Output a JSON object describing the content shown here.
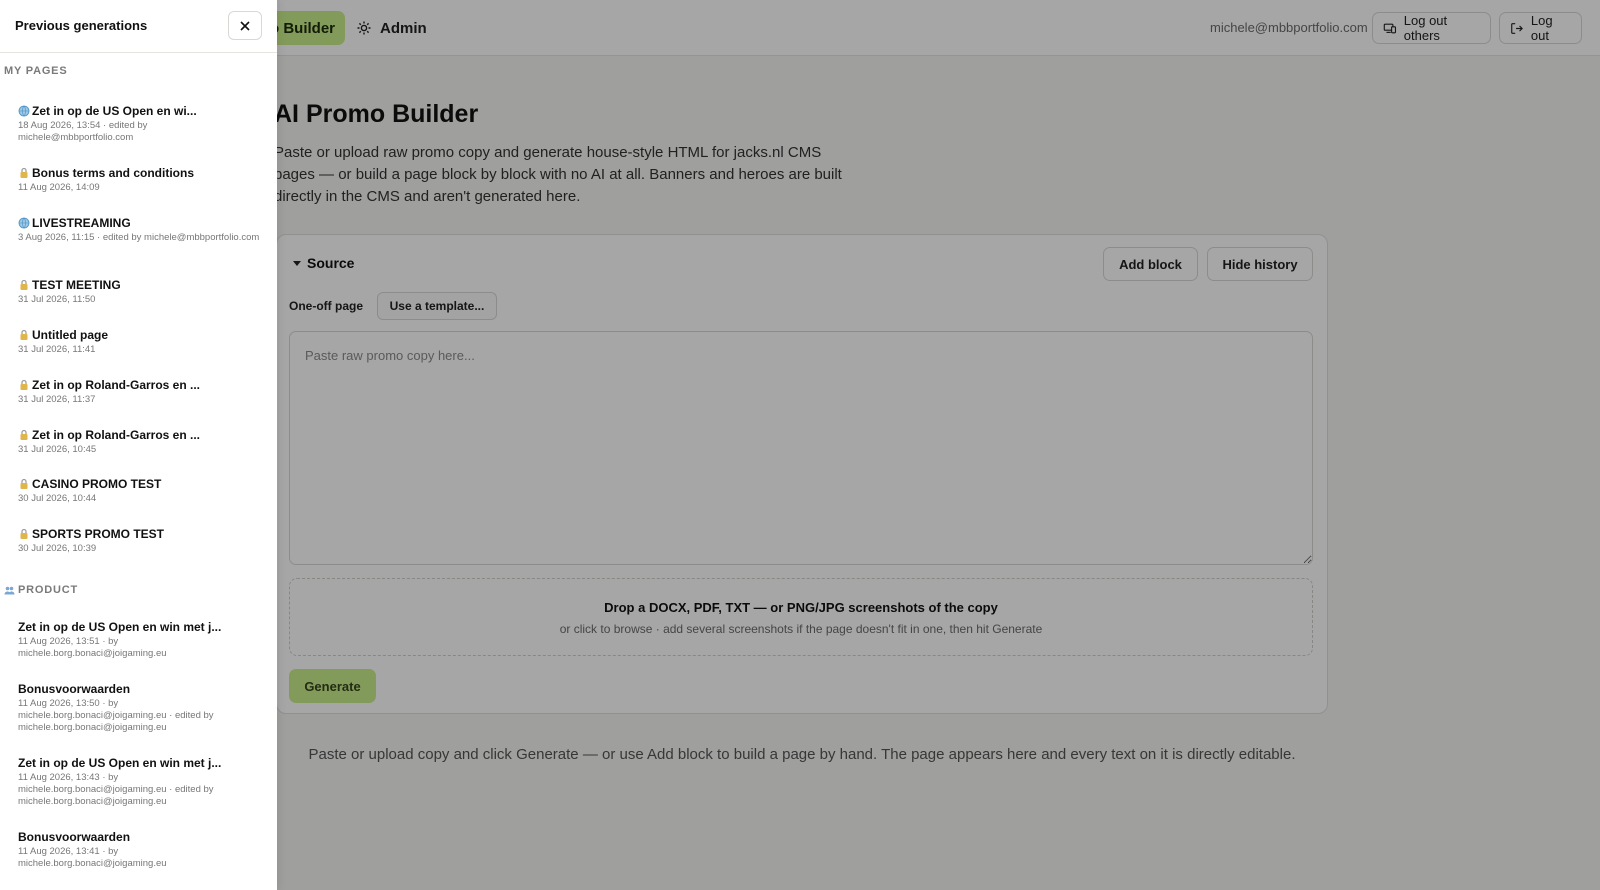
{
  "topbar": {
    "active_nav": "o Builder",
    "admin_nav": "Admin",
    "user_email": "michele@mbbportfolio.com",
    "logout_others": "Log out others",
    "logout": "Log out"
  },
  "page": {
    "title": "AI Promo Builder",
    "description": "Paste or upload raw promo copy and generate house-style HTML for jacks.nl CMS pages — or build a page block by block with no AI at all. Banners and heroes are built directly in the CMS and aren't generated here."
  },
  "source": {
    "toggle_label": "Source",
    "add_block": "Add block",
    "hide_history": "Hide history",
    "mode_label": "One-off page",
    "template_button": "Use a template...",
    "input_placeholder": "Paste raw promo copy here...",
    "drop_title": "Drop a DOCX, PDF, TXT — or PNG/JPG screenshots of the copy",
    "drop_sub": "or click to browse · add several screenshots if the page doesn't fit in one, then hit Generate",
    "generate": "Generate"
  },
  "empty_hint": "Paste or upload copy and click Generate — or use Add block to build a page by hand. The page appears here and every text on it is directly editable.",
  "drawer": {
    "title": "Previous generations",
    "my_pages_label": "MY PAGES",
    "my_pages": [
      {
        "icon": "globe",
        "title": "Zet in op de US Open en wi...",
        "meta": "18 Aug 2026, 13:54 · edited by michele@mbbportfolio.com"
      },
      {
        "icon": "lock",
        "title": "Bonus terms and conditions",
        "meta": "11 Aug 2026, 14:09"
      },
      {
        "icon": "globe",
        "title": "LIVESTREAMING",
        "meta": "3 Aug 2026, 11:15 · edited by michele@mbbportfolio.com"
      },
      {
        "icon": "lock",
        "title": "TEST MEETING",
        "meta": "31 Jul 2026, 11:50"
      },
      {
        "icon": "lock",
        "title": "Untitled page",
        "meta": "31 Jul 2026, 11:41"
      },
      {
        "icon": "lock",
        "title": "Zet in op Roland-Garros en ...",
        "meta": "31 Jul 2026, 11:37"
      },
      {
        "icon": "lock",
        "title": "Zet in op Roland-Garros en ...",
        "meta": "31 Jul 2026, 10:45"
      },
      {
        "icon": "lock",
        "title": "CASINO PROMO TEST",
        "meta": "30 Jul 2026, 10:44"
      },
      {
        "icon": "lock",
        "title": "SPORTS PROMO TEST",
        "meta": "30 Jul 2026, 10:39"
      }
    ],
    "product_label": "PRODUCT",
    "product": [
      {
        "title": "Zet in op de US Open en win met j...",
        "meta": "11 Aug 2026, 13:51 · by michele.borg.bonaci@joigaming.eu"
      },
      {
        "title": "Bonusvoorwaarden",
        "meta": "11 Aug 2026, 13:50 · by michele.borg.bonaci@joigaming.eu · edited by michele.borg.bonaci@joigaming.eu"
      },
      {
        "title": "Zet in op de US Open en win met j...",
        "meta": "11 Aug 2026, 13:43 · by michele.borg.bonaci@joigaming.eu · edited by michele.borg.bonaci@joigaming.eu"
      },
      {
        "title": "Bonusvoorwaarden",
        "meta": "11 Aug 2026, 13:41 · by michele.borg.bonaci@joigaming.eu"
      }
    ]
  },
  "colors": {
    "accent": "#c9ef8a",
    "overlay": "rgba(0,0,0,0.35)"
  }
}
